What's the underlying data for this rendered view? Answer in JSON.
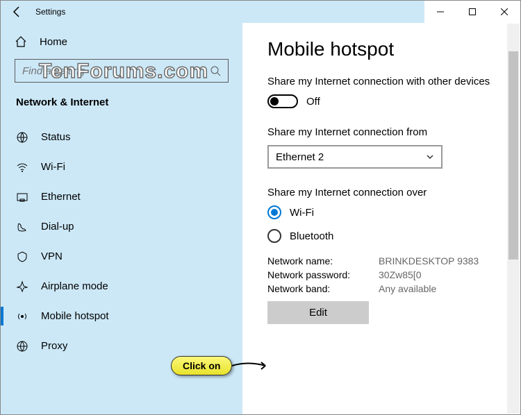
{
  "window": {
    "title": "Settings"
  },
  "sidebar": {
    "home": "Home",
    "search_placeholder": "Find a setting",
    "category": "Network & Internet",
    "items": [
      {
        "label": "Status"
      },
      {
        "label": "Wi-Fi"
      },
      {
        "label": "Ethernet"
      },
      {
        "label": "Dial-up"
      },
      {
        "label": "VPN"
      },
      {
        "label": "Airplane mode"
      },
      {
        "label": "Mobile hotspot"
      },
      {
        "label": "Proxy"
      }
    ]
  },
  "main": {
    "title": "Mobile hotspot",
    "share_label": "Share my Internet connection with other devices",
    "toggle_state": "Off",
    "from_label": "Share my Internet connection from",
    "from_value": "Ethernet 2",
    "over_label": "Share my Internet connection over",
    "radio_wifi": "Wi-Fi",
    "radio_bt": "Bluetooth",
    "info": {
      "name_key": "Network name:",
      "name_val": "BRINKDESKTOP 9383",
      "pass_key": "Network password:",
      "pass_val": "30Zw85[0",
      "band_key": "Network band:",
      "band_val": "Any available"
    },
    "edit_label": "Edit"
  },
  "callout": "Click on",
  "watermark": "TenForums.com"
}
